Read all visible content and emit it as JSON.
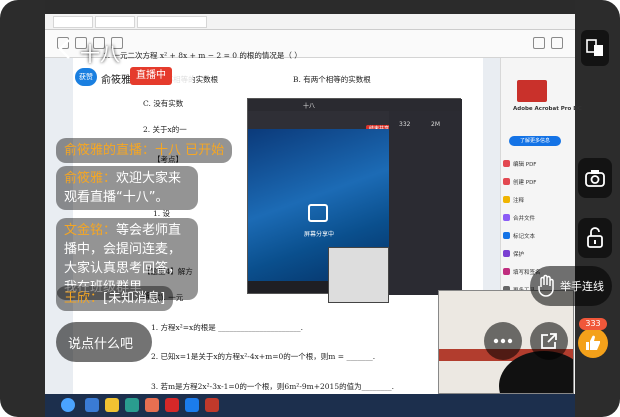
{
  "room": {
    "title": "十八",
    "host_name": "俞筱雅",
    "host_badge": "获赞",
    "live_badge": "直播中"
  },
  "pdf": {
    "questions": [
      "1. 一元二次方程 x² + 8x + m − 2 = 0 的根的情况是（    ）",
      "A. 有两个不相等的实数根",
      "B. 有两个相等的实数根",
      "C. 没有实数",
      "2. 关于x的一",
      "【考点】",
      "1. 设",
      "【题型4】解方",
      "解",
      "1. 方程x²=x的根是 ______________________.",
      "2. 已知x=1是关于x的方程x²-4x+m=0的一个根，则m = _______.",
      "3. 若m是方程2x²-3x-1=0的一个根，则6m²-9m+2015的值为________."
    ],
    "sidenote": "式). 一元"
  },
  "acrobat": {
    "title": "Adobe Acrobat Pro DC",
    "items": [
      "编辑 PDF",
      "创建 PDF",
      "注释",
      "合并文件",
      "标记文本",
      "保护",
      "填写和签名",
      "更多工具"
    ],
    "promo": "了解更多信息"
  },
  "meeting": {
    "title": "十八",
    "status_text": "屏幕分享中",
    "end_label": "结束共享",
    "stats": [
      "332",
      "2M"
    ]
  },
  "chat": [
    {
      "name": "俞筱雅的直播：",
      "text": "十八 已开始",
      "system": true
    },
    {
      "name": "俞筱雅：",
      "text": "欢迎大家来观看直播“十八”。"
    },
    {
      "name": "文金铭：",
      "text": "等会老师直播中，会提问连麦，大家认真思考回答，我在班级群里"
    },
    {
      "name": "王欣：",
      "text": "[未知消息]"
    }
  ],
  "controls": {
    "talk_label": "说点什么吧",
    "raise_label": "举手连线",
    "like_count": "333"
  },
  "colors": {
    "live_red": "#e53b2c",
    "like_orange": "#f4a11a",
    "name_gold": "#f5a623"
  }
}
